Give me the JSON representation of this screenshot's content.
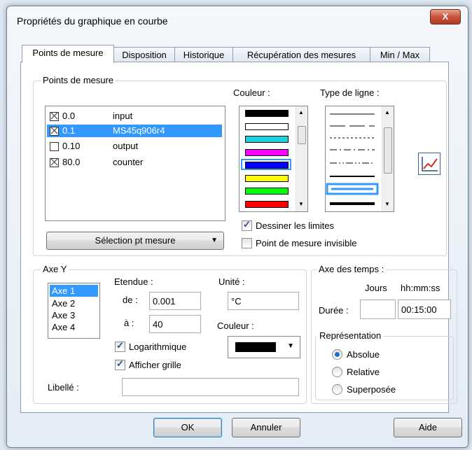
{
  "window": {
    "title": "Propriétés du graphique en courbe",
    "close_label": "X"
  },
  "tabs": [
    "Points de mesure",
    "Disposition",
    "Historique",
    "Récupération des mesures",
    "Min / Max"
  ],
  "points": {
    "legend": "Points de mesure",
    "rows": [
      {
        "checked": true,
        "value": "0.0",
        "name": "input",
        "selected": false
      },
      {
        "checked": true,
        "value": "0.1",
        "name": "MS45q906r4",
        "selected": true
      },
      {
        "checked": false,
        "value": "0.10",
        "name": "output",
        "selected": false
      },
      {
        "checked": true,
        "value": "80.0",
        "name": "counter",
        "selected": false
      }
    ],
    "select_button_label": "Sélection pt mesure",
    "couleur_label": "Couleur :",
    "type_ligne_label": "Type de ligne :",
    "colors": [
      "#000000",
      "#ffffff",
      "#17d3de",
      "#ff00ff",
      "#0000ff",
      "#ffff00",
      "#00ff00",
      "#ff0000"
    ],
    "selected_color_index": 4,
    "dessiner_limites": {
      "label": "Dessiner les limites",
      "checked": true
    },
    "invisible": {
      "label": "Point de mesure invisible",
      "checked": false
    }
  },
  "axey": {
    "legend": "Axe Y",
    "axes": [
      "Axe 1",
      "Axe 2",
      "Axe 3",
      "Axe 4"
    ],
    "etendue_label": "Etendue :",
    "de_label": "de :",
    "de_value": "0.001",
    "a_label": "à :",
    "a_value": "40",
    "unite_label": "Unité :",
    "unite_value": "°C",
    "couleur_label": "Couleur :",
    "couleur_value": "#000000",
    "log_label": "Logarithmique",
    "log_checked": true,
    "grille_label": "Afficher grille",
    "grille_checked": true,
    "libelle_label": "Libellé :",
    "libelle_value": ""
  },
  "temps": {
    "legend": "Axe des temps :",
    "jours_label": "Jours",
    "hms_label": "hh:mm:ss",
    "duree_label": "Durée :",
    "jours_value": "",
    "hms_value": "00:15:00",
    "repr_legend": "Représentation",
    "options": [
      "Absolue",
      "Relative",
      "Superposée"
    ],
    "selected": 0
  },
  "buttons": {
    "ok": "OK",
    "annuler": "Annuler",
    "aide": "Aide"
  }
}
